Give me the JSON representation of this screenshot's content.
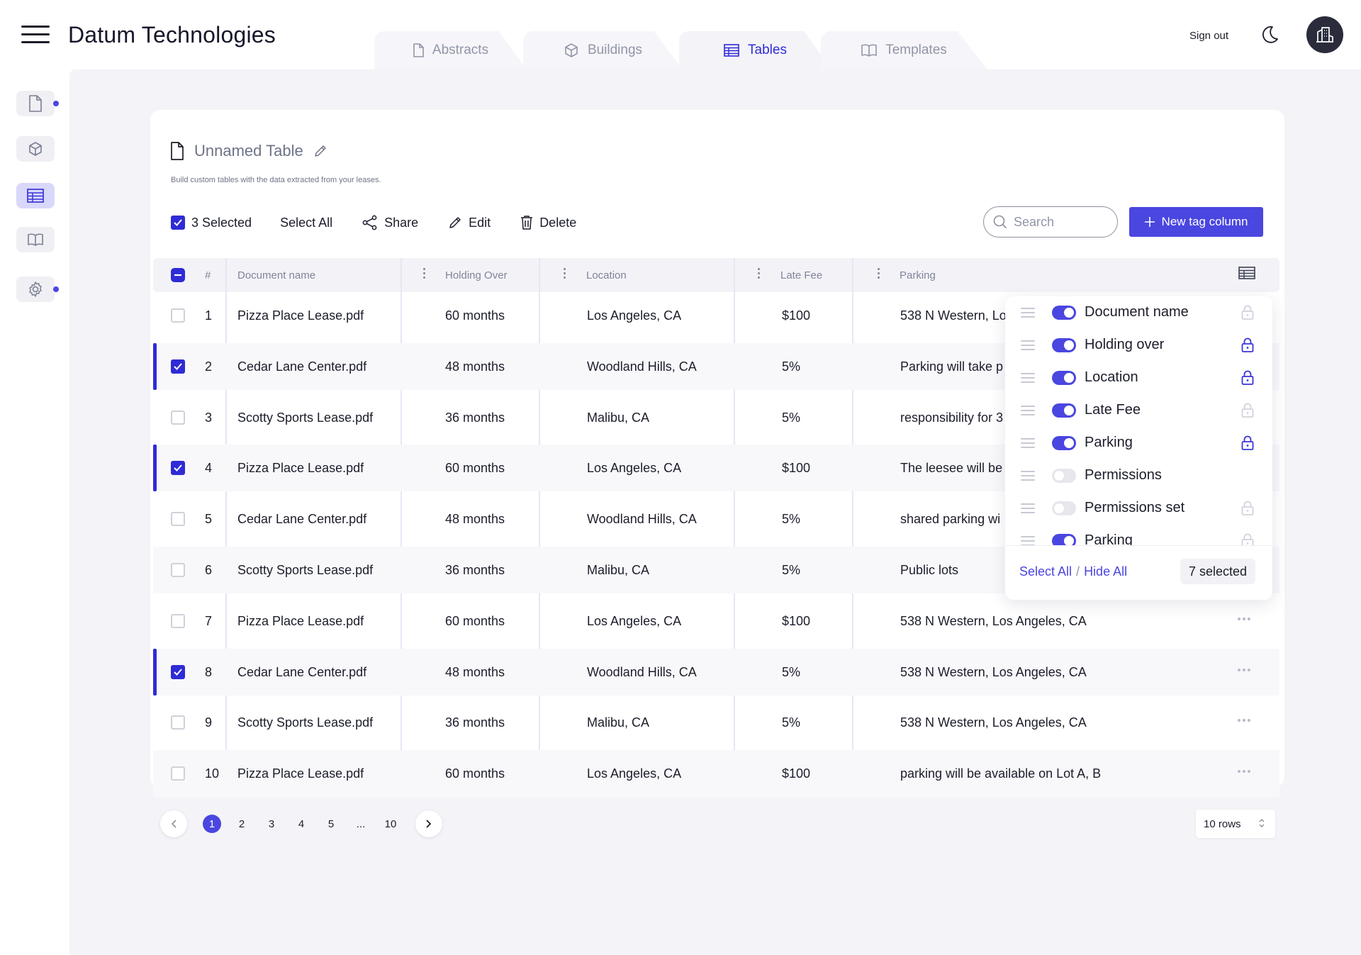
{
  "app": {
    "brand": "Datum Technologies"
  },
  "tabs": [
    {
      "label": "Abstracts",
      "icon": "file-icon",
      "active": false
    },
    {
      "label": "Buildings",
      "icon": "cube-icon",
      "active": false
    },
    {
      "label": "Tables",
      "icon": "table-icon",
      "active": true
    },
    {
      "label": "Templates",
      "icon": "book-icon",
      "active": false
    }
  ],
  "header": {
    "signout_label": "Sign out"
  },
  "sidebar": {
    "items": [
      {
        "name": "documents",
        "icon": "file-icon",
        "badge": true
      },
      {
        "name": "buildings",
        "icon": "cube-icon",
        "badge": false
      },
      {
        "name": "tables",
        "icon": "table-icon",
        "active": true,
        "badge": false
      },
      {
        "name": "templates",
        "icon": "book-icon",
        "badge": false
      },
      {
        "name": "settings",
        "icon": "gear-icon",
        "badge": true
      }
    ]
  },
  "page": {
    "title": "Unnamed Table",
    "subtitle": "Build custom tables with the data extracted from your leases."
  },
  "toolbar": {
    "selected_label": "3 Selected",
    "select_all": "Select All",
    "share": "Share",
    "edit": "Edit",
    "delete": "Delete",
    "search_placeholder": "Search",
    "new_column": "New tag column"
  },
  "table": {
    "columns": [
      "#",
      "Document name",
      "Holding Over",
      "Location",
      "Late Fee",
      "Parking"
    ],
    "rows": [
      {
        "num": "1",
        "doc": "Pizza Place Lease.pdf",
        "holding": "60 months",
        "location": "Los Angeles, CA",
        "fee": "$100",
        "parking": "538 N Western, Lo",
        "checked": false
      },
      {
        "num": "2",
        "doc": "Cedar Lane Center.pdf",
        "holding": "48 months",
        "location": "Woodland Hills, CA",
        "fee": "5%",
        "parking": "Parking will take p",
        "checked": true
      },
      {
        "num": "3",
        "doc": "Scotty Sports Lease.pdf",
        "holding": "36 months",
        "location": "Malibu, CA",
        "fee": "5%",
        "parking": "responsibility for 3",
        "checked": false
      },
      {
        "num": "4",
        "doc": "Pizza Place Lease.pdf",
        "holding": "60 months",
        "location": "Los Angeles, CA",
        "fee": "$100",
        "parking": "The leesee will be",
        "checked": true
      },
      {
        "num": "5",
        "doc": "Cedar Lane Center.pdf",
        "holding": "48 months",
        "location": "Woodland Hills, CA",
        "fee": "5%",
        "parking": "shared parking wi",
        "checked": false
      },
      {
        "num": "6",
        "doc": "Scotty Sports Lease.pdf",
        "holding": "36 months",
        "location": "Malibu, CA",
        "fee": "5%",
        "parking": "Public lots",
        "checked": false
      },
      {
        "num": "7",
        "doc": "Pizza Place Lease.pdf",
        "holding": "60 months",
        "location": "Los Angeles, CA",
        "fee": "$100",
        "parking": "538 N Western, Los Angeles, CA",
        "checked": false
      },
      {
        "num": "8",
        "doc": "Cedar Lane Center.pdf",
        "holding": "48 months",
        "location": "Woodland Hills, CA",
        "fee": "5%",
        "parking": "538 N Western, Los Angeles, CA",
        "checked": true
      },
      {
        "num": "9",
        "doc": "Scotty Sports Lease.pdf",
        "holding": "36 months",
        "location": "Malibu, CA",
        "fee": "5%",
        "parking": "538 N Western, Los Angeles, CA",
        "checked": false
      },
      {
        "num": "10",
        "doc": "Pizza Place Lease.pdf",
        "holding": "60 months",
        "location": "Los Angeles, CA",
        "fee": "$100",
        "parking": "parking will be available on Lot A, B",
        "checked": false
      }
    ]
  },
  "column_picker": {
    "items": [
      {
        "label": "Document name",
        "on": true,
        "locked": false
      },
      {
        "label": "Holding over",
        "on": true,
        "locked": true
      },
      {
        "label": "Location",
        "on": true,
        "locked": true
      },
      {
        "label": "Late Fee",
        "on": true,
        "locked": false
      },
      {
        "label": "Parking",
        "on": true,
        "locked": true
      },
      {
        "label": "Permissions",
        "on": false,
        "locked": null
      },
      {
        "label": "Permissions set",
        "on": false,
        "locked": false
      },
      {
        "label": "Parking",
        "on": true,
        "locked": false
      }
    ],
    "select_all": "Select All",
    "hide_all": "Hide All",
    "count": "7 selected"
  },
  "pagination": {
    "pages": [
      "1",
      "2",
      "3",
      "4",
      "5",
      "...",
      "10"
    ],
    "current": "1",
    "rows_per_page": "10 rows"
  },
  "colors": {
    "accent": "#4a46e0",
    "accent_dark": "#2f2bd6",
    "muted": "#80849a"
  }
}
